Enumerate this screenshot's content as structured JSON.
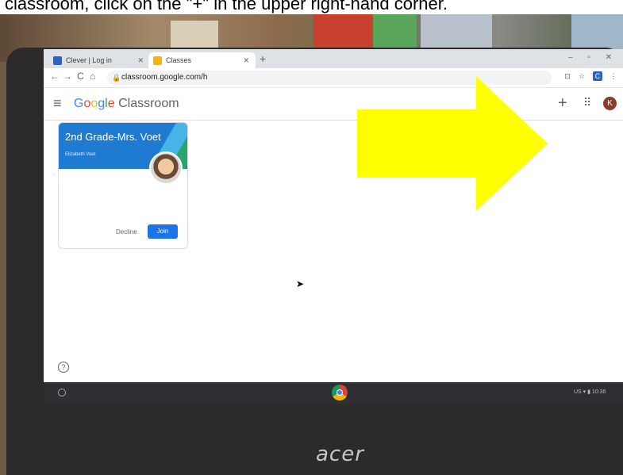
{
  "caption": "classroom, click on the \"+\" in the upper right-hand corner.",
  "laptop": {
    "brand": "acer"
  },
  "browser": {
    "tabs": [
      {
        "label": "Clever | Log in",
        "favicon_color": "#2864c8",
        "favicon": "C"
      },
      {
        "label": "Classes",
        "favicon_color": "#f4b400",
        "favicon": "▦"
      }
    ],
    "new_tab_icon": "+",
    "window_controls": "–  ▫  ✕",
    "nav_icons": [
      "←",
      "→",
      "C",
      "⌂"
    ],
    "url": "classroom.google.com/h",
    "extensions": [
      {
        "icon": "cast-icon",
        "glyph": "⊡"
      },
      {
        "icon": "star-icon",
        "glyph": "☆"
      },
      {
        "icon": "clever-icon",
        "glyph": "C"
      },
      {
        "icon": "more-icon",
        "glyph": "⋮"
      }
    ]
  },
  "appbar": {
    "menu_icon": "≡",
    "logo_google": "Google",
    "logo_product": " Classroom",
    "create_join_icon": "+",
    "apps_icon": "⋮⋮⋮",
    "account_initial": "K"
  },
  "class_card": {
    "title": "2nd Grade-Mrs. Voet",
    "teacher": "Elizabeth Voet",
    "decline_label": "Decline",
    "join_label": "Join"
  },
  "help_icon": "?",
  "shelf": {
    "tray_text": "US  ▾  ▮  10:36"
  },
  "annotation": {
    "color": "#ffff00"
  }
}
